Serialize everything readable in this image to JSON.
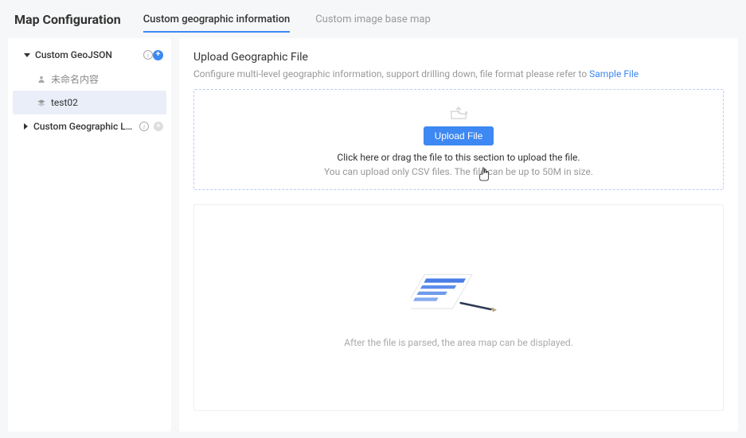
{
  "header": {
    "title": "Map Configuration",
    "tabs": [
      {
        "label": "Custom geographic information",
        "active": true
      },
      {
        "label": "Custom image base map",
        "active": false
      }
    ]
  },
  "sidebar": {
    "geojson": {
      "label": "Custom GeoJSON",
      "items": [
        {
          "label": "未命名内容"
        },
        {
          "label": "test02"
        }
      ]
    },
    "layers": {
      "label": "Custom Geographic L…"
    }
  },
  "main": {
    "title": "Upload Geographic File",
    "desc_prefix": "Configure multi-level geographic information, support drilling down, file format please refer to ",
    "desc_link": "Sample File",
    "upload_button": "Upload File",
    "dropzone_line": "Click here or drag the file to this section to upload the file.",
    "dropzone_sub": "You can upload only CSV files. The file can be up to 50M in size.",
    "preview_text": "After the file is parsed, the area map can be displayed."
  }
}
